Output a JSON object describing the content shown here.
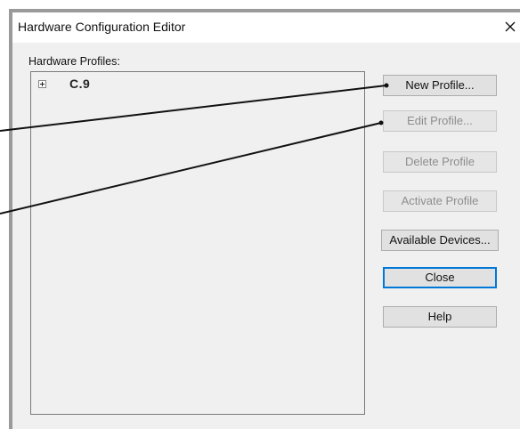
{
  "window": {
    "title": "Hardware Configuration Editor",
    "close_glyph": "✕"
  },
  "profiles": {
    "label": "Hardware Profiles:",
    "items": [
      {
        "label": "C.9",
        "expand_icon": "plus-box-icon"
      }
    ]
  },
  "buttons": {
    "new_profile": "New Profile...",
    "edit_profile": "Edit Profile...",
    "delete_profile": "Delete Profile",
    "activate_profile": "Activate Profile",
    "available_devices": "Available Devices...",
    "close": "Close",
    "help": "Help"
  },
  "colors": {
    "focus_border": "#0078d7",
    "disabled_text": "#8d8d8d",
    "callout_line": "#111111"
  }
}
